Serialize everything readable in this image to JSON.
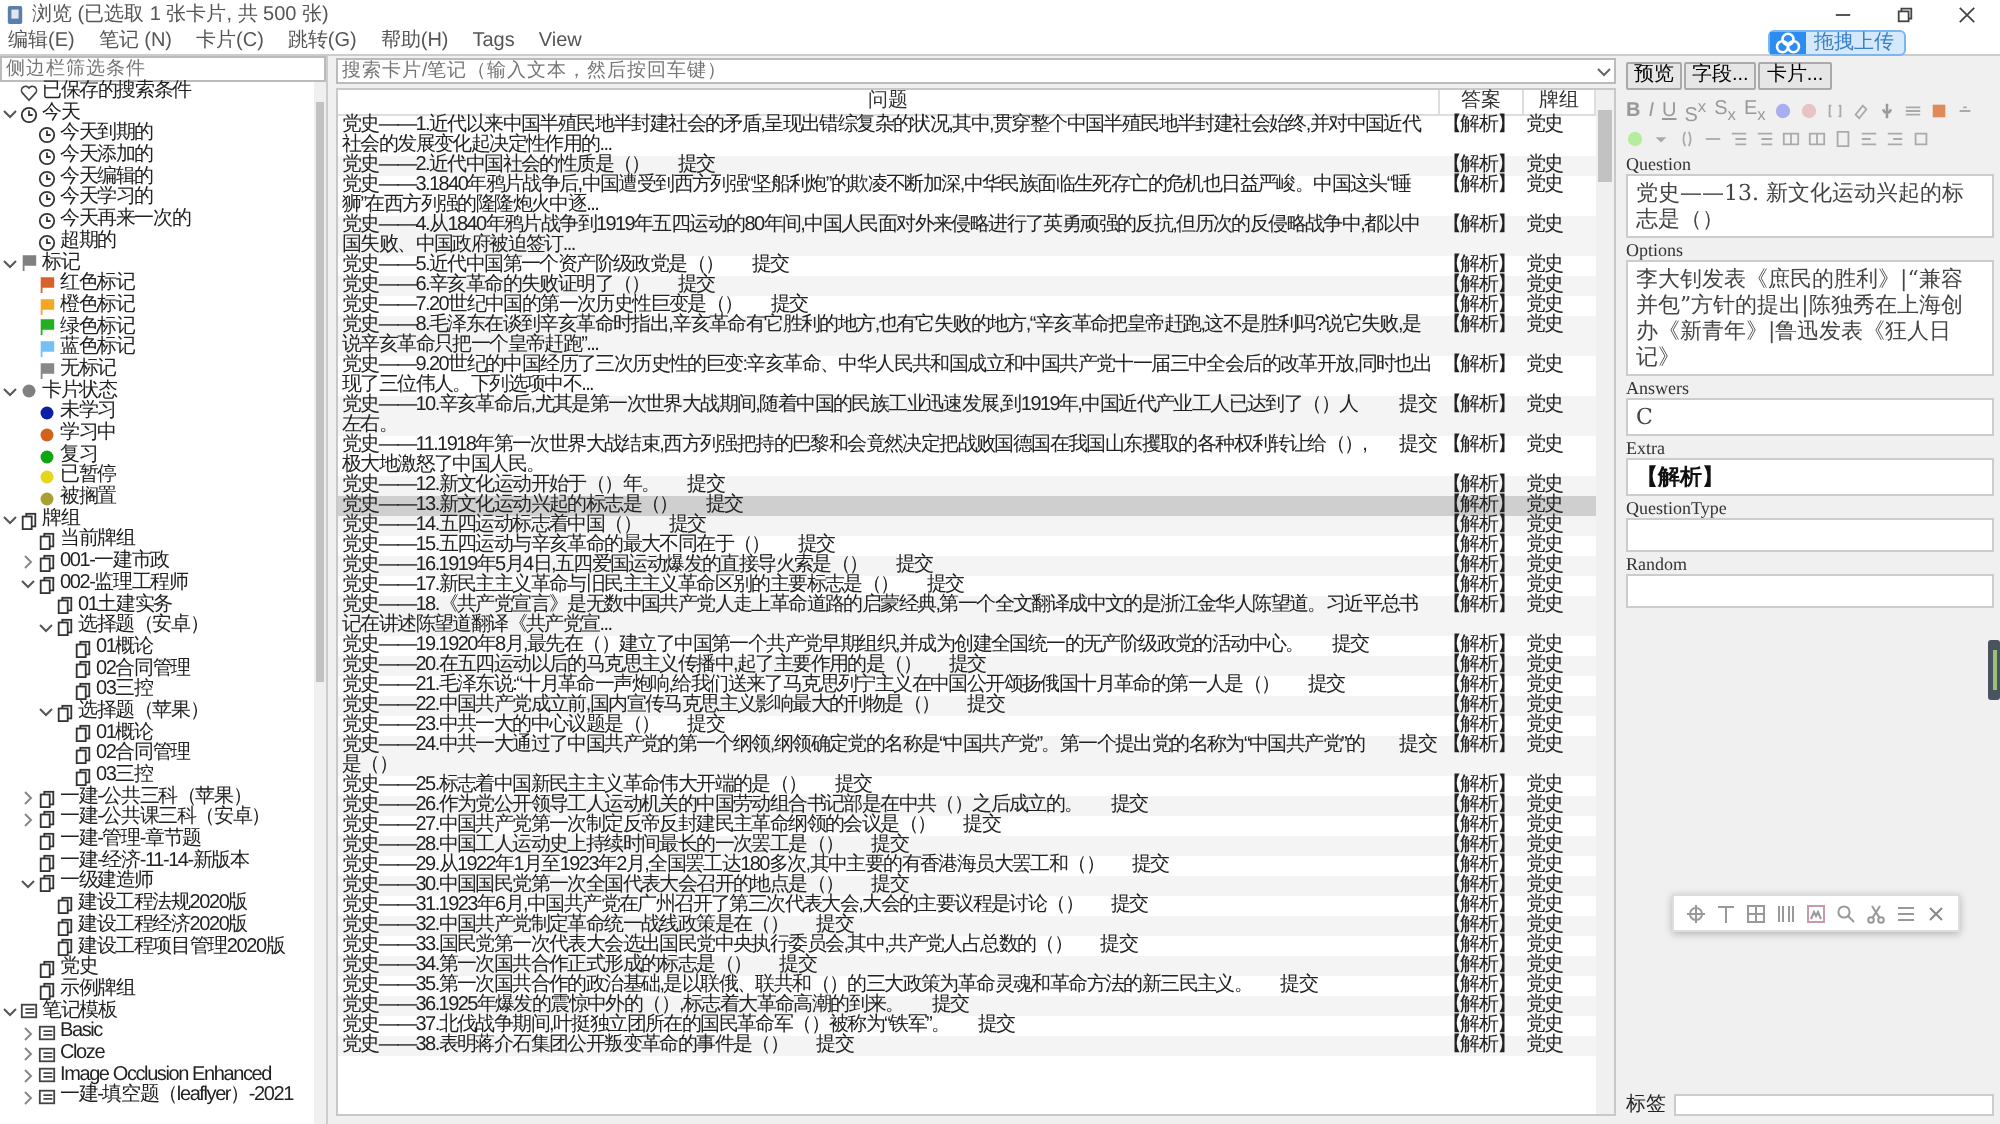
{
  "window": {
    "title": "浏览 (已选取 1 张卡片, 共 500 张)"
  },
  "menu": [
    "编辑(E)",
    "笔记 (N)",
    "卡片(C)",
    "跳转(G)",
    "帮助(H)",
    "Tags",
    "View"
  ],
  "upload_badge": "拖拽上传",
  "sidebar": {
    "filter_placeholder": "侧边栏筛选条件",
    "items": [
      {
        "label": "已保存的搜索条件",
        "kind": "saved"
      },
      {
        "label": "今天",
        "kind": "clock",
        "expanded": true,
        "children": [
          {
            "label": "今天到期的",
            "kind": "clock"
          },
          {
            "label": "今天添加的",
            "kind": "clock"
          },
          {
            "label": "今天编辑的",
            "kind": "clock"
          },
          {
            "label": "今天学习的",
            "kind": "clock"
          },
          {
            "label": "今天再来一次的",
            "kind": "clock"
          },
          {
            "label": "超期的",
            "kind": "clock"
          }
        ]
      },
      {
        "label": "标记",
        "kind": "flag",
        "color": "#808080",
        "expanded": true,
        "children": [
          {
            "label": "红色标记",
            "kind": "flag",
            "color": "#d9622b"
          },
          {
            "label": "橙色标记",
            "kind": "flag",
            "color": "#f5a623"
          },
          {
            "label": "绿色标记",
            "kind": "flag",
            "color": "#22b022"
          },
          {
            "label": "蓝色标记",
            "kind": "flag",
            "color": "#74c0f5"
          },
          {
            "label": "无标记",
            "kind": "flag",
            "color": "#888888"
          }
        ]
      },
      {
        "label": "卡片状态",
        "kind": "status",
        "color": "#808080",
        "expanded": true,
        "children": [
          {
            "label": "未学习",
            "kind": "status",
            "color": "#0b1ea6"
          },
          {
            "label": "学习中",
            "kind": "status",
            "color": "#d2611c"
          },
          {
            "label": "复习",
            "kind": "status",
            "color": "#11a611"
          },
          {
            "label": "已暂停",
            "kind": "status",
            "color": "#e6d61a"
          },
          {
            "label": "被搁置",
            "kind": "status",
            "color": "#a8a035"
          }
        ]
      },
      {
        "label": "牌组",
        "kind": "deck",
        "expanded": true,
        "children": [
          {
            "label": "当前牌组",
            "kind": "deck"
          },
          {
            "label": "001-一建市政",
            "kind": "deck",
            "expanded": false
          },
          {
            "label": "002-监理工程师",
            "kind": "deck",
            "expanded": true,
            "children": [
              {
                "label": "01土建实务",
                "kind": "deck"
              },
              {
                "label": "选择题（安卓）",
                "kind": "deck",
                "expanded": true,
                "children": [
                  {
                    "label": "01概论",
                    "kind": "deck"
                  },
                  {
                    "label": "02合同管理",
                    "kind": "deck"
                  },
                  {
                    "label": "03三控",
                    "kind": "deck"
                  }
                ]
              },
              {
                "label": "选择题（苹果）",
                "kind": "deck",
                "expanded": true,
                "children": [
                  {
                    "label": "01概论",
                    "kind": "deck"
                  },
                  {
                    "label": "02合同管理",
                    "kind": "deck"
                  },
                  {
                    "label": "03三控",
                    "kind": "deck"
                  }
                ]
              }
            ]
          },
          {
            "label": "一建-公共三科（苹果）",
            "kind": "deck",
            "expanded": false
          },
          {
            "label": "一建-公共课三科（安卓）",
            "kind": "deck",
            "expanded": false
          },
          {
            "label": "一建-管理-章节题",
            "kind": "deck"
          },
          {
            "label": "一建-经济-11-14-新版本",
            "kind": "deck"
          },
          {
            "label": "一级建造师",
            "kind": "deck",
            "expanded": true,
            "children": [
              {
                "label": "建设工程法规2020版",
                "kind": "deck"
              },
              {
                "label": "建设工程经济2020版",
                "kind": "deck"
              },
              {
                "label": "建设工程项目管理2020版",
                "kind": "deck"
              }
            ]
          },
          {
            "label": "党史",
            "kind": "deck"
          },
          {
            "label": "示例牌组",
            "kind": "deck"
          }
        ]
      },
      {
        "label": "笔记模板",
        "kind": "notetype",
        "expanded": true,
        "children": [
          {
            "label": "Basic",
            "kind": "notetype",
            "expanded": false
          },
          {
            "label": "Cloze",
            "kind": "notetype",
            "expanded": false
          },
          {
            "label": "Image Occlusion Enhanced",
            "kind": "notetype",
            "expanded": false
          },
          {
            "label": "一建-填空题（leaflyer）-2021",
            "kind": "notetype",
            "expanded": false
          }
        ]
      }
    ]
  },
  "search": {
    "placeholder": "搜索卡片/笔记（输入文本，然后按回车键）"
  },
  "table": {
    "columns": [
      "问题",
      "答案",
      "牌组"
    ],
    "rows": [
      {
        "question": "党史——1.近代以来中国半殖民地半封建社会的矛盾,呈现出错综复杂的状况,其中,贯穿整个中国半殖民地半封建社会始终,并对中国近代社会的发展变化起决定性作用的...",
        "answer": "【解析】",
        "deck": "党史",
        "selected": false
      },
      {
        "question": "党史——2.近代中国社会的性质是（）",
        "submit": "提交",
        "answer": "【解析】",
        "deck": "党史",
        "selected": false
      },
      {
        "question": "党史——3.1840年鸦片战争后,中国遭受到西方列强“坚船利炮”的欺凌不断加深,中华民族面临生死存亡的危机也日益严峻。中国这头“睡狮”在西方列强的隆隆炮火中逐...",
        "answer": "【解析】",
        "deck": "党史",
        "selected": false
      },
      {
        "question": "党史——4.从1840年鸦片战争到1919年五四运动的80年间,中国人民面对外来侵略进行了英勇顽强的反抗,但历次的反侵略战争中,都以中国失败、中国政府被迫签订...",
        "answer": "【解析】",
        "deck": "党史",
        "selected": false
      },
      {
        "question": "党史——5.近代中国第一个资产阶级政党是（）",
        "submit": "提交",
        "answer": "【解析】",
        "deck": "党史",
        "selected": false
      },
      {
        "question": "党史——6.辛亥革命的失败证明了（）",
        "submit": "提交",
        "answer": "【解析】",
        "deck": "党史",
        "selected": false
      },
      {
        "question": "党史——7.20世纪中国的第一次历史性巨变是（）",
        "submit": "提交",
        "answer": "【解析】",
        "deck": "党史",
        "selected": false
      },
      {
        "question": "党史——8.毛泽东在谈到辛亥革命时指出,辛亥革命有它胜利的地方,也有它失败的地方,“辛亥革命把皇帝赶跑,这不是胜利吗?说它失败,是说辛亥革命只把一个皇帝赶跑”...",
        "answer": "【解析】",
        "deck": "党史",
        "selected": false
      },
      {
        "question": "党史——9.20世纪的中国经历了三次历史性的巨变:辛亥革命、中华人民共和国成立和中国共产党十一届三中全会后的改革开放,同时也出现了三位伟人。下列选项中不...",
        "answer": "【解析】",
        "deck": "党史",
        "selected": false
      },
      {
        "question": "党史——10.辛亥革命后,尤其是第一次世界大战期间,随着中国的民族工业迅速发展,到1919年,中国近代产业工人已达到了（）人左右。",
        "submit": "提交",
        "answer": "【解析】",
        "deck": "党史",
        "selected": false
      },
      {
        "question": "党史——11.1918年第一次世界大战结束,西方列强把持的巴黎和会竟然决定把战败国德国在我国山东攫取的各种权利转让给（）,极大地激怒了中国人民。",
        "submit": "提交",
        "answer": "【解析】",
        "deck": "党史",
        "selected": false
      },
      {
        "question": "党史——12.新文化运动开始于（）年。",
        "submit": "提交",
        "answer": "【解析】",
        "deck": "党史",
        "selected": false
      },
      {
        "question": "党史——13.新文化运动兴起的标志是（）",
        "submit": "提交",
        "answer": "【解析】",
        "deck": "党史",
        "selected": true
      },
      {
        "question": "党史——14.五四运动标志着中国（）",
        "submit": "提交",
        "answer": "【解析】",
        "deck": "党史",
        "selected": false
      },
      {
        "question": "党史——15.五四运动与辛亥革命的最大不同在于（）",
        "submit": "提交",
        "answer": "【解析】",
        "deck": "党史",
        "selected": false
      },
      {
        "question": "党史——16.1919年5月4日,五四爱国运动爆发的直接导火索是（）",
        "submit": "提交",
        "answer": "【解析】",
        "deck": "党史",
        "selected": false
      },
      {
        "question": "党史——17.新民主主义革命与旧民主主义革命区别的主要标志是（）",
        "submit": "提交",
        "answer": "【解析】",
        "deck": "党史",
        "selected": false
      },
      {
        "question": "党史——18.《共产党宣言》是无数中国共产党人走上革命道路的启蒙经典,第一个全文翻译成中文的是浙江金华人陈望道。习近平总书记在讲述陈望道翻译《共产党宣...",
        "answer": "【解析】",
        "deck": "党史",
        "selected": false
      },
      {
        "question": "党史——19.1920年8月,最先在（）建立了中国第一个共产党早期组织,并成为创建全国统一的无产阶级政党的活动中心。",
        "submit": "提交",
        "answer": "【解析】",
        "deck": "党史",
        "selected": false
      },
      {
        "question": "党史——20.在五四运动以后的马克思主义传播中,起了主要作用的是（）",
        "submit": "提交",
        "answer": "【解析】",
        "deck": "党史",
        "selected": false
      },
      {
        "question": "党史——21.毛泽东说:“十月革命一声炮响,给我们送来了马克思列宁主义在中国公开颂扬俄国十月革命的第一人是（）",
        "submit": "提交",
        "answer": "【解析】",
        "deck": "党史",
        "selected": false
      },
      {
        "question": "党史——22.中国共产党成立前,国内宣传马克思主义影响最大的刊物是（）",
        "submit": "提交",
        "answer": "【解析】",
        "deck": "党史",
        "selected": false
      },
      {
        "question": "党史——23.中共一大的中心议题是（）",
        "submit": "提交",
        "answer": "【解析】",
        "deck": "党史",
        "selected": false
      },
      {
        "question": "党史——24.中共一大通过了中国共产党的第一个纲领,纲领确定党的名称是“中国共产党”。第一个提出党的名称为“中国共产党”的是（）",
        "submit": "提交",
        "answer": "【解析】",
        "deck": "党史",
        "selected": false
      },
      {
        "question": "党史——25.标志着中国新民主主义革命伟大开端的是（）",
        "submit": "提交",
        "answer": "【解析】",
        "deck": "党史",
        "selected": false
      },
      {
        "question": "党史——26.作为党公开领导工人运动机关的中国劳动组合书记部是在中共（）之后成立的。",
        "submit": "提交",
        "answer": "【解析】",
        "deck": "党史",
        "selected": false
      },
      {
        "question": "党史——27.中国共产党第一次制定反帝反封建民主革命纲领的会议是（）",
        "submit": "提交",
        "answer": "【解析】",
        "deck": "党史",
        "selected": false
      },
      {
        "question": "党史——28.中国工人运动史上持续时间最长的一次罢工是（）",
        "submit": "提交",
        "answer": "【解析】",
        "deck": "党史",
        "selected": false
      },
      {
        "question": "党史——29.从1922年1月至1923年2月,全国罢工达180多次,其中主要的有香港海员大罢工和（）",
        "submit": "提交",
        "answer": "【解析】",
        "deck": "党史",
        "selected": false
      },
      {
        "question": "党史——30.中国国民党第一次全国代表大会召开的地点是（）",
        "submit": "提交",
        "answer": "【解析】",
        "deck": "党史",
        "selected": false
      },
      {
        "question": "党史——31.1923年6月,中国共产党在广州召开了第三次代表大会,大会的主要议程是讨论（）",
        "submit": "提交",
        "answer": "【解析】",
        "deck": "党史",
        "selected": false
      },
      {
        "question": "党史——32.中国共产党制定革命统一战线政策是在（）",
        "submit": "提交",
        "answer": "【解析】",
        "deck": "党史",
        "selected": false
      },
      {
        "question": "党史——33.国民党第一次代表大会选出国民党中央执行委员会,其中,共产党人占总数的（）",
        "submit": "提交",
        "answer": "【解析】",
        "deck": "党史",
        "selected": false
      },
      {
        "question": "党史——34.第一次国共合作正式形成的标志是（）",
        "submit": "提交",
        "answer": "【解析】",
        "deck": "党史",
        "selected": false
      },
      {
        "question": "党史——35.第一次国共合作的政治基础,是以联俄、联共和（）的三大政策为革命灵魂和革命方法的新三民主义。",
        "submit": "提交",
        "answer": "【解析】",
        "deck": "党史",
        "selected": false
      },
      {
        "question": "党史——36.1925年爆发的震惊中外的（）,标志着大革命高潮的到来。",
        "submit": "提交",
        "answer": "【解析】",
        "deck": "党史",
        "selected": false
      },
      {
        "question": "党史——37.北伐战争期间,叶挺独立团所在的国民革命军（）被称为“铁军”。",
        "submit": "提交",
        "answer": "【解析】",
        "deck": "党史",
        "selected": false
      },
      {
        "question": "党史——38.表明蒋介石集团公开叛变革命的事件是（）",
        "submit": "提交",
        "answer": "【解析】",
        "deck": "党史",
        "selected": false
      }
    ]
  },
  "editor": {
    "buttons": [
      "预览",
      "字段...",
      "卡片..."
    ],
    "format_buttons": [
      "B",
      "I",
      "U",
      "S$^{x}$",
      "S$_{x}$",
      "E$_{x}$"
    ],
    "fields": [
      {
        "label": "Question",
        "value": "党史——13. 新文化运动兴起的标志是（）",
        "bold": false
      },
      {
        "label": "Options",
        "value": "李大钊发表《庶民的胜利》|“兼容并包”方针的提出|陈独秀在上海创办《新青年》|鲁迅发表《狂人日记》",
        "bold": false
      },
      {
        "label": "Answers",
        "value": "C",
        "bold": false
      },
      {
        "label": "Extra",
        "value": "【解析】",
        "bold": true
      },
      {
        "label": "QuestionType"
      },
      {
        "label": "Random"
      }
    ],
    "tags_label": "标签"
  }
}
